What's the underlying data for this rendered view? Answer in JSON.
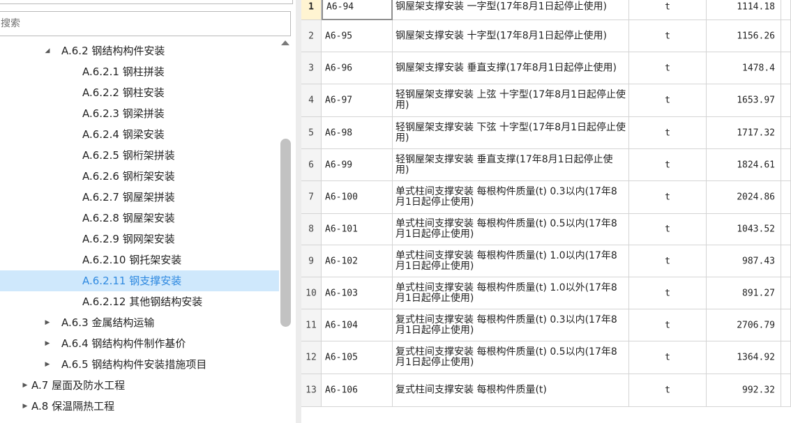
{
  "search": {
    "placeholder": "搜索"
  },
  "tree": [
    {
      "label": "A.6.2 钢结构构件安装",
      "arrow": "◢",
      "level": 2,
      "selected": false
    },
    {
      "label": "A.6.2.1 钢柱拼装",
      "arrow": "",
      "level": 3,
      "selected": false
    },
    {
      "label": "A.6.2.2 钢柱安装",
      "arrow": "",
      "level": 3,
      "selected": false
    },
    {
      "label": "A.6.2.3 钢梁拼装",
      "arrow": "",
      "level": 3,
      "selected": false
    },
    {
      "label": "A.6.2.4 钢梁安装",
      "arrow": "",
      "level": 3,
      "selected": false
    },
    {
      "label": "A.6.2.5 钢桁架拼装",
      "arrow": "",
      "level": 3,
      "selected": false
    },
    {
      "label": "A.6.2.6 钢桁架安装",
      "arrow": "",
      "level": 3,
      "selected": false
    },
    {
      "label": "A.6.2.7 钢屋架拼装",
      "arrow": "",
      "level": 3,
      "selected": false
    },
    {
      "label": "A.6.2.8 钢屋架安装",
      "arrow": "",
      "level": 3,
      "selected": false
    },
    {
      "label": "A.6.2.9 钢网架安装",
      "arrow": "",
      "level": 3,
      "selected": false
    },
    {
      "label": "A.6.2.10 钢托架安装",
      "arrow": "",
      "level": 3,
      "selected": false
    },
    {
      "label": "A.6.2.11 钢支撑安装",
      "arrow": "",
      "level": 3,
      "selected": true
    },
    {
      "label": "A.6.2.12 其他钢结构安装",
      "arrow": "",
      "level": 3,
      "selected": false
    },
    {
      "label": "A.6.3 金属结构运输",
      "arrow": "▶",
      "level": 2,
      "selected": false
    },
    {
      "label": "A.6.4 钢结构构件制作基价",
      "arrow": "▶",
      "level": 2,
      "selected": false
    },
    {
      "label": "A.6.5 钢结构构件安装措施项目",
      "arrow": "▶",
      "level": 2,
      "selected": false
    },
    {
      "label": "A.7 屋面及防水工程",
      "arrow": "▶",
      "level": 1,
      "selected": false
    },
    {
      "label": "A.8 保温隔热工程",
      "arrow": "▶",
      "level": 1,
      "selected": false
    }
  ],
  "rows": [
    {
      "index": "1",
      "code": "A6-94",
      "name": "钢屋架支撑安装 一字型(17年8月1日起停止使用)",
      "unit": "t",
      "price": "1114.18",
      "active": true
    },
    {
      "index": "2",
      "code": "A6-95",
      "name": "钢屋架支撑安装 十字型(17年8月1日起停止使用)",
      "unit": "t",
      "price": "1156.26",
      "active": false
    },
    {
      "index": "3",
      "code": "A6-96",
      "name": "钢屋架支撑安装 垂直支撑(17年8月1日起停止使用)",
      "unit": "t",
      "price": "1478.4",
      "active": false
    },
    {
      "index": "4",
      "code": "A6-97",
      "name": "轻钢屋架支撑安装 上弦 十字型(17年8月1日起停止使用)",
      "unit": "t",
      "price": "1653.97",
      "active": false
    },
    {
      "index": "5",
      "code": "A6-98",
      "name": "轻钢屋架支撑安装 下弦 十字型(17年8月1日起停止使用)",
      "unit": "t",
      "price": "1717.32",
      "active": false
    },
    {
      "index": "6",
      "code": "A6-99",
      "name": "轻钢屋架支撑安装 垂直支撑(17年8月1日起停止使用)",
      "unit": "t",
      "price": "1824.61",
      "active": false
    },
    {
      "index": "7",
      "code": "A6-100",
      "name": "单式柱间支撑安装 每根构件质量(t) 0.3以内(17年8月1日起停止使用)",
      "unit": "t",
      "price": "2024.86",
      "active": false
    },
    {
      "index": "8",
      "code": "A6-101",
      "name": "单式柱间支撑安装 每根构件质量(t) 0.5以内(17年8月1日起停止使用)",
      "unit": "t",
      "price": "1043.52",
      "active": false
    },
    {
      "index": "9",
      "code": "A6-102",
      "name": "单式柱间支撑安装 每根构件质量(t) 1.0以内(17年8月1日起停止使用)",
      "unit": "t",
      "price": "987.43",
      "active": false
    },
    {
      "index": "10",
      "code": "A6-103",
      "name": "单式柱间支撑安装 每根构件质量(t) 1.0以外(17年8月1日起停止使用)",
      "unit": "t",
      "price": "891.27",
      "active": false
    },
    {
      "index": "11",
      "code": "A6-104",
      "name": "复式柱间支撑安装 每根构件质量(t) 0.3以内(17年8月1日起停止使用)",
      "unit": "t",
      "price": "2706.79",
      "active": false
    },
    {
      "index": "12",
      "code": "A6-105",
      "name": "复式柱间支撑安装 每根构件质量(t) 0.5以内(17年8月1日起停止使用)",
      "unit": "t",
      "price": "1364.92",
      "active": false
    },
    {
      "index": "13",
      "code": "A6-106",
      "name": "复式柱间支撑安装 每根构件质量(t)",
      "unit": "t",
      "price": "992.32",
      "active": false
    }
  ]
}
